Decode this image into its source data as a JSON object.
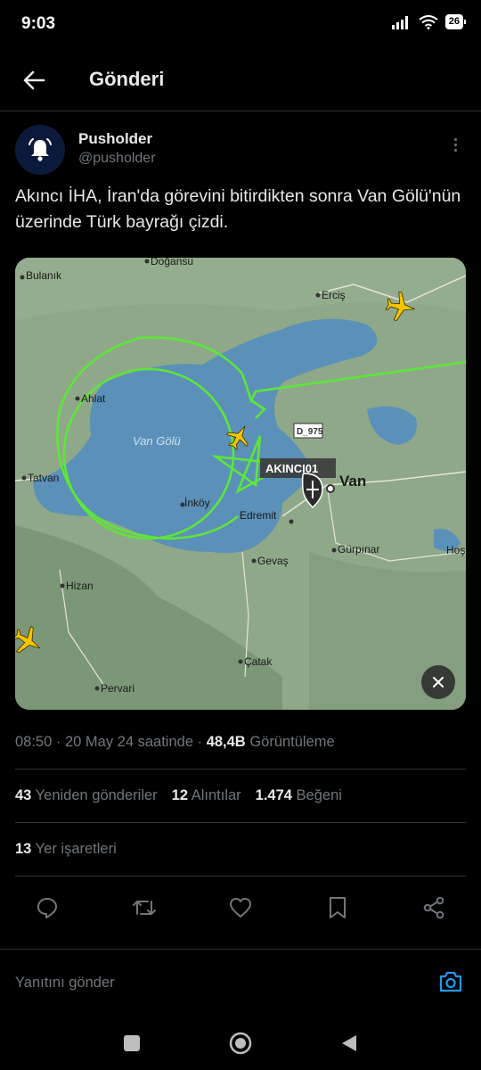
{
  "status_bar": {
    "time": "9:03",
    "battery": "26"
  },
  "header": {
    "title": "Gönderi"
  },
  "author": {
    "name": "Pusholder",
    "handle": "@pusholder"
  },
  "post": {
    "text": "Akıncı İHA, İran'da görevini bitirdikten sonra Van Gölü'nün üzerinde Türk bayrağı çizdi."
  },
  "map": {
    "lake_label": "Van Gölü",
    "flight_label": "AKINCI01",
    "road_label": "D_975",
    "places": [
      "Doğansu",
      "Bulanık",
      "Erciş",
      "Ahlat",
      "Tatvan",
      "Van",
      "İnköy",
      "Edremit",
      "Gürpınar",
      "Gevaş",
      "Hizan",
      "Çatak",
      "Pervari",
      "Hoş"
    ]
  },
  "meta": {
    "time": "08:50",
    "date_text": "20 May 24 saatinde",
    "separator": "·",
    "views_count": "48,4B",
    "views_label": "Görüntüleme"
  },
  "stats": {
    "reposts_count": "43",
    "reposts_label": "Yeniden gönderiler",
    "quotes_count": "12",
    "quotes_label": "Alıntılar",
    "likes_count": "1.474",
    "likes_label": "Beğeni",
    "bookmarks_count": "13",
    "bookmarks_label": "Yer işaretleri"
  },
  "reply": {
    "placeholder": "Yanıtını gönder"
  },
  "colors": {
    "background": "#000000",
    "accent": "#1d9bf0",
    "muted": "#71767b",
    "flight_path": "#5de63a"
  }
}
